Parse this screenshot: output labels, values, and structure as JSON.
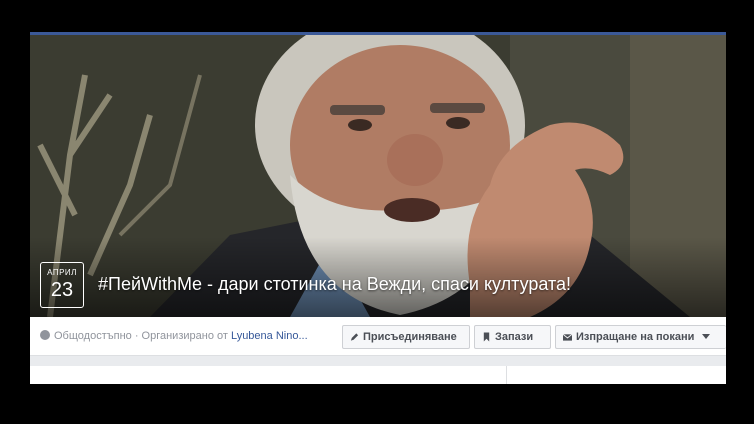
{
  "event": {
    "date_month": "АПРИЛ",
    "date_day": "23",
    "title": "#ПейWithMe - дари стотинка на Вежди, спаси културата!"
  },
  "meta": {
    "privacy": "Общодостъпно",
    "separator": " · ",
    "organized_by": "Организирано от",
    "organizer": "Lyubena Nino..."
  },
  "actions": {
    "join": "Присъединяване",
    "save": "Запази",
    "invite": "Изпращане на покани"
  },
  "colors": {
    "brand": "#3b5998",
    "link": "#365899"
  },
  "icons": {
    "privacy": "globe-icon",
    "join": "pencil-icon",
    "save": "bookmark-icon",
    "invite": "envelope-icon"
  }
}
